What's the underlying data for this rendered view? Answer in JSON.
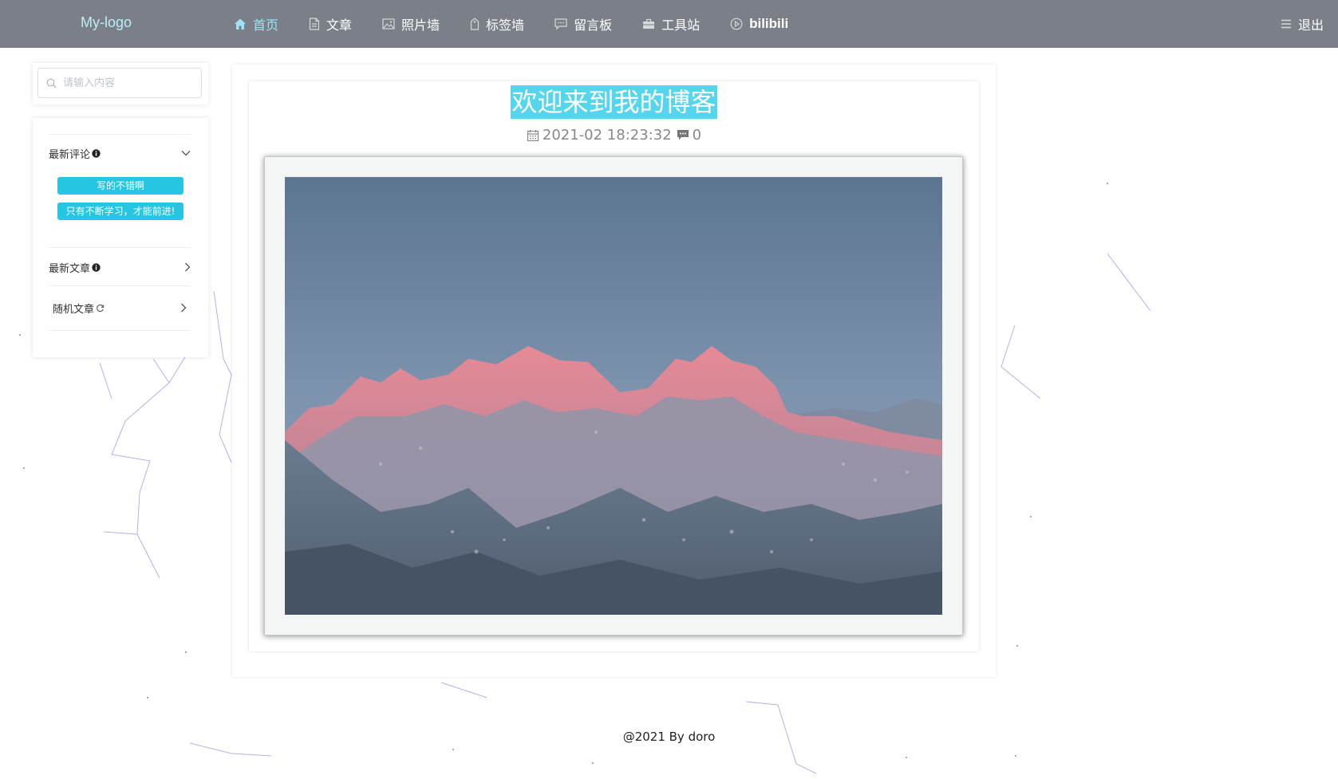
{
  "header": {
    "logo": "My-logo",
    "nav": [
      {
        "label": "首页",
        "icon": "home-icon",
        "active": true
      },
      {
        "label": "文章",
        "icon": "document-icon"
      },
      {
        "label": "照片墙",
        "icon": "picture-icon"
      },
      {
        "label": "标签墙",
        "icon": "tag-icon"
      },
      {
        "label": "留言板",
        "icon": "message-icon"
      },
      {
        "label": "工具站",
        "icon": "toolbox-icon"
      },
      {
        "label": "bilibili",
        "icon": "play-circle-icon"
      }
    ],
    "logout": "退出"
  },
  "sidebar": {
    "search_placeholder": "请输入内容",
    "sections": {
      "latest_comments": {
        "title": "最新评论",
        "expanded": true,
        "items": [
          "写的不错啊",
          "只有不断学习，才能前进!"
        ]
      },
      "latest_articles": {
        "title": "最新文章",
        "expanded": false
      },
      "random_articles": {
        "title": "随机文章",
        "expanded": false
      }
    }
  },
  "post": {
    "title": "欢迎来到我的博客",
    "date": "2021-02 18:23:32",
    "comment_count": "0"
  },
  "footer": "@2021 By doro",
  "colors": {
    "topbar": "#7b8088",
    "accent": "#26c6e3",
    "title_highlight": "#56d6ee",
    "active_nav": "#9fe3f3"
  }
}
